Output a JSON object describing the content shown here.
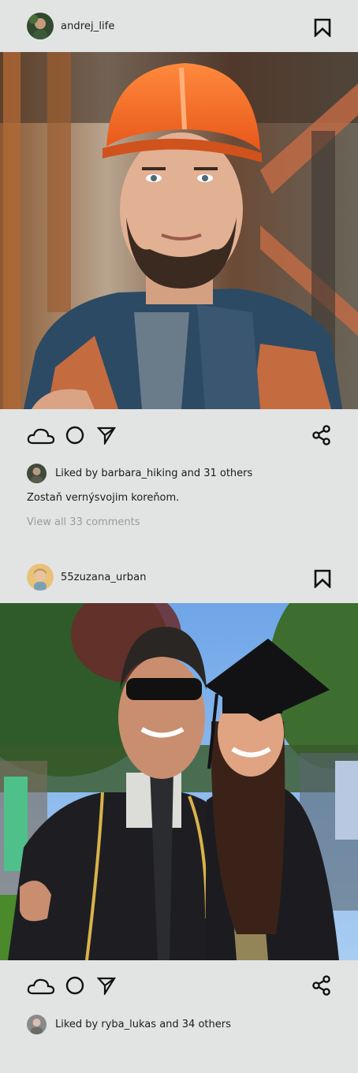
{
  "posts": [
    {
      "username": "andrej_life",
      "avatar_icon": "user-avatar",
      "photo_alt": "",
      "liked_prefix": "Liked by",
      "liked_user": "barbara_hiking",
      "liked_suffix": "and 31 others",
      "caption": "Zostaň vernýsvojim koreňom.",
      "comments_link": "View all 33 comments"
    },
    {
      "username": "55zuzana_urban",
      "avatar_icon": "user-avatar",
      "liked_prefix": "Liked by",
      "liked_user": "ryba_lukas",
      "liked_suffix": "and 34 others"
    }
  ],
  "icons": {
    "bookmark": "bookmark-icon",
    "like": "cloud-like-icon",
    "comment": "circle-comment-icon",
    "send": "send-arrow-icon",
    "share": "share-icon"
  },
  "colors": {
    "background": "#e2e4e3",
    "text": "#1b1b1b",
    "muted_text": "#9a9c9b"
  }
}
